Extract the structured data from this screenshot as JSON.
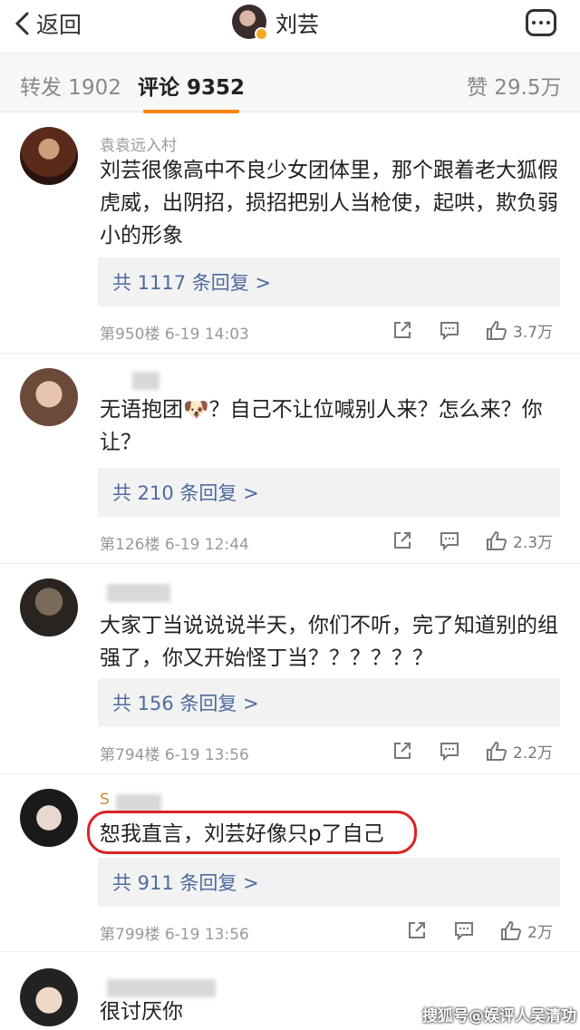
{
  "nav": {
    "back_label": "返回",
    "title": "刘芸"
  },
  "tabs": {
    "repost": "转发 1902",
    "comments": "评论 9352",
    "likes": "赞 29.5万"
  },
  "comments": [
    {
      "username": "袁袁远入村",
      "text": "刘芸很像高中不良少女团体里，那个跟着老大狐假虎威，出阴招，损招把别人当枪使，起哄，欺负弱小的形象",
      "replies": "共 1117 条回复 >",
      "meta": "第950楼 6-19 14:03",
      "likes": "3.7万"
    },
    {
      "username": "",
      "text": "无语抱团🐶？自己不让位喊别人来？怎么来？你让？",
      "replies": "共 210 条回复 >",
      "meta": "第126楼 6-19 12:44",
      "likes": "2.3万"
    },
    {
      "username": "",
      "text": "大家丁当说说说半天，你们不听，完了知道别的组强了，你又开始怪丁当？？？？？？",
      "replies": "共 156 条回复 >",
      "meta": "第794楼 6-19 13:56",
      "likes": "2.2万"
    },
    {
      "username": "S",
      "text": "恕我直言，刘芸好像只p了自己",
      "replies": "共 911 条回复 >",
      "meta": "第799楼 6-19 13:56",
      "likes": "2万"
    },
    {
      "username": "",
      "text": "很讨厌你"
    }
  ],
  "watermark": "搜狐号@娱评人吴清功",
  "colors": {
    "accent": "#ff8200",
    "link": "#4e6b9f",
    "highlight": "#dd2222"
  }
}
